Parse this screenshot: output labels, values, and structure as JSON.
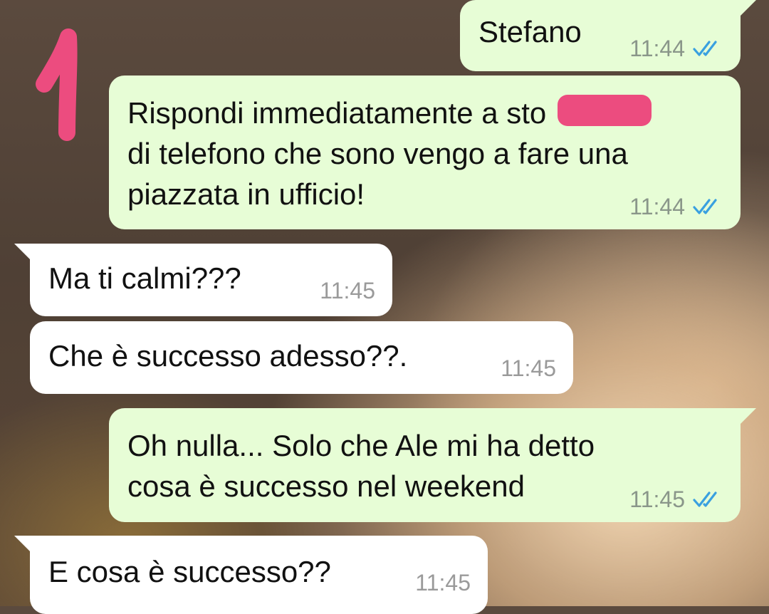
{
  "chat": {
    "messages": [
      {
        "direction": "outgoing",
        "text": "Stefano",
        "time": "11:44",
        "status": "read-double-tick"
      },
      {
        "direction": "outgoing",
        "text_before_redaction": "Rispondi immediatamente a sto",
        "text_after_redaction": "di telefono che sono vengo a fare una\npiazzata in ufficio!",
        "time": "11:44",
        "status": "read-double-tick"
      },
      {
        "direction": "incoming",
        "text": "Ma ti calmi???",
        "time": "11:45"
      },
      {
        "direction": "incoming",
        "text": "Che è successo adesso??.",
        "time": "11:45"
      },
      {
        "direction": "outgoing",
        "text": "Oh nulla... Solo che Ale mi ha detto\ncosa è successo nel weekend",
        "time": "11:45",
        "status": "read-double-tick"
      },
      {
        "direction": "incoming",
        "text": "E cosa è successo??",
        "time": "11:45"
      }
    ]
  },
  "colors": {
    "outgoing_bubble": "#e7fdd6",
    "incoming_bubble": "#ffffff",
    "read_tick": "#3aa0e0",
    "redaction": "#ec4c7f",
    "annotation_marker": "#ec4c7f"
  },
  "annotations": {
    "marker_icon": "handwritten-one-marker"
  }
}
